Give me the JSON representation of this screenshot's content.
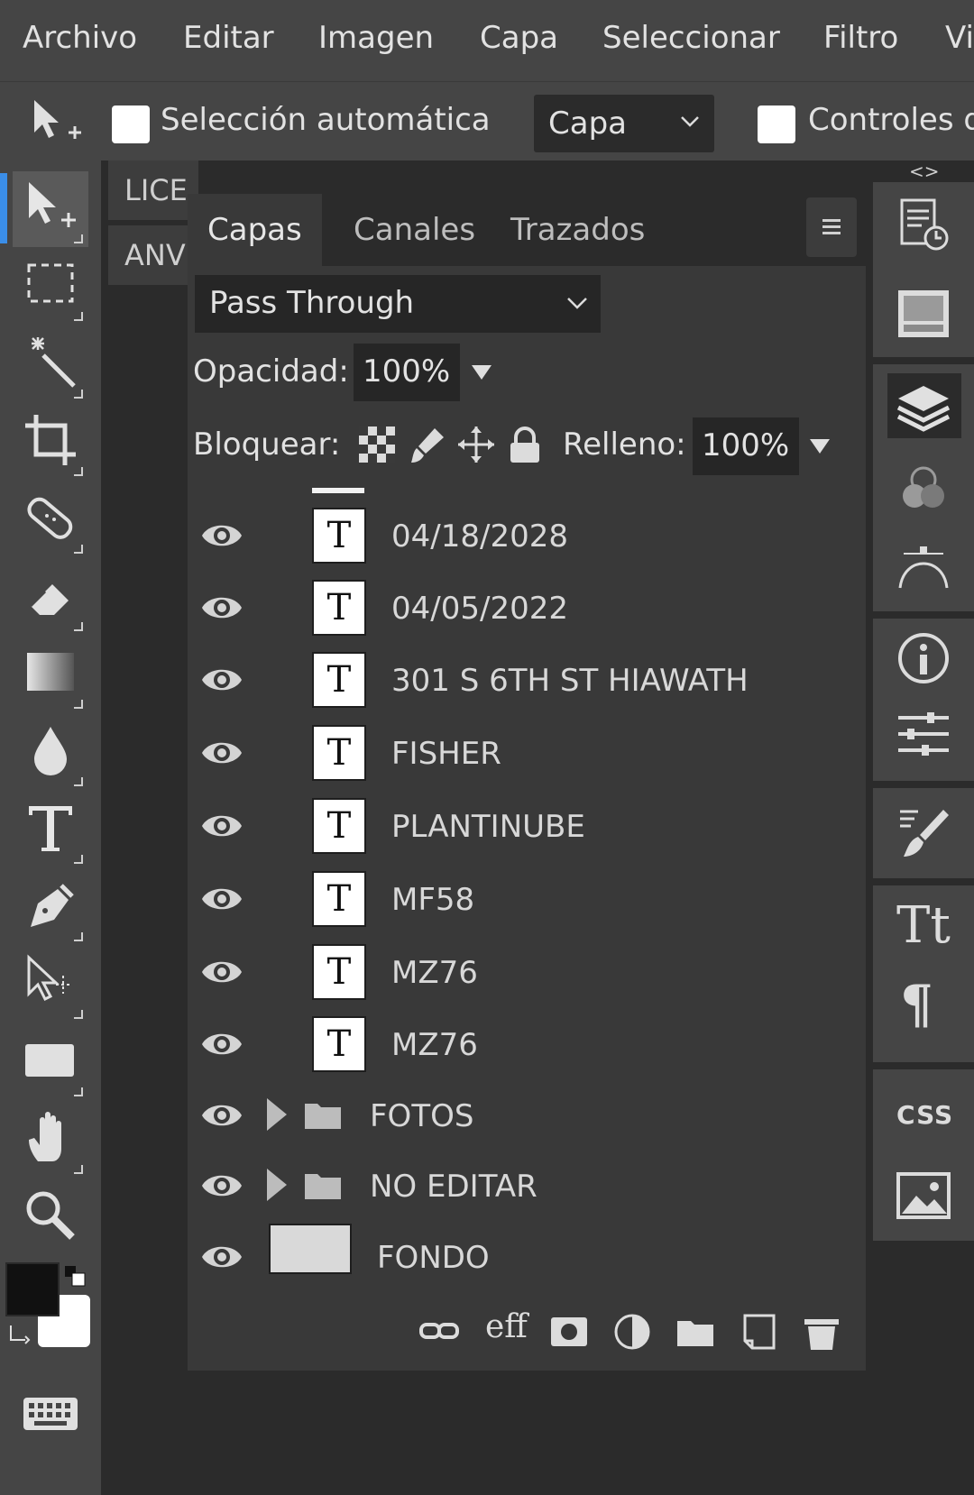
{
  "menu": [
    "Archivo",
    "Editar",
    "Imagen",
    "Capa",
    "Seleccionar",
    "Filtro",
    "Vi"
  ],
  "options": {
    "auto_select_label": "Selección automática",
    "layer_select_value": "Capa",
    "controls_label": "Controles d"
  },
  "doc_tabs": [
    "LICE",
    "ANV"
  ],
  "panel": {
    "tabs": [
      "Capas",
      "Canales",
      "Trazados"
    ],
    "blend_mode": "Pass Through",
    "opacity_label": "Opacidad:",
    "opacity_value": "100%",
    "lock_label": "Bloquear:",
    "fill_label": "Relleno:",
    "fill_value": "100%"
  },
  "layers": [
    {
      "name": "04/18/2028",
      "kind": "text"
    },
    {
      "name": "04/05/2022",
      "kind": "text"
    },
    {
      "name": "301 S 6TH ST HIAWATH",
      "kind": "text"
    },
    {
      "name": "FISHER",
      "kind": "text"
    },
    {
      "name": "PLANTINUBE",
      "kind": "text"
    },
    {
      "name": "MF58",
      "kind": "text"
    },
    {
      "name": "MZ76",
      "kind": "text"
    },
    {
      "name": "MZ76",
      "kind": "text"
    },
    {
      "name": "FOTOS",
      "kind": "folder"
    },
    {
      "name": "NO EDITAR",
      "kind": "folder"
    },
    {
      "name": "FONDO",
      "kind": "image"
    }
  ],
  "text_thumb_glyph": "T",
  "footer_eff": "eff",
  "dock": {
    "collapse": "<>",
    "css_label": "CSS",
    "text_tt": "Tt",
    "para": "¶"
  },
  "colors": {
    "accent": "#3b8ee8",
    "ui_bg": "#454545",
    "panel_bg": "#393939",
    "dark_bg": "#2b2b2b"
  }
}
